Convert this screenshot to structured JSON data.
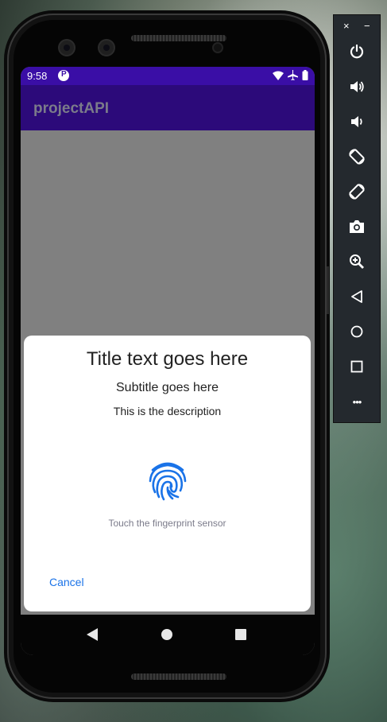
{
  "status_bar": {
    "time": "9:58"
  },
  "app_bar": {
    "title": "projectAPI"
  },
  "dialog": {
    "title": "Title text goes here",
    "subtitle": "Subtitle goes here",
    "description": "This is the description",
    "hint": "Touch the fingerprint sensor",
    "cancel_label": "Cancel"
  },
  "colors": {
    "status_bar": "#3a0ea6",
    "app_bar": "#2c0a7a",
    "scrim": "#808080",
    "fingerprint": "#1a73e8",
    "cancel": "#1a73e8"
  },
  "emulator_toolbar": {
    "close_label": "×",
    "minimize_label": "−",
    "more_label": "•••",
    "items": [
      "power-icon",
      "volume-up-icon",
      "volume-down-icon",
      "rotate-left-icon",
      "rotate-right-icon",
      "camera-icon",
      "zoom-icon",
      "back-icon",
      "home-icon",
      "overview-icon",
      "more-icon"
    ]
  }
}
